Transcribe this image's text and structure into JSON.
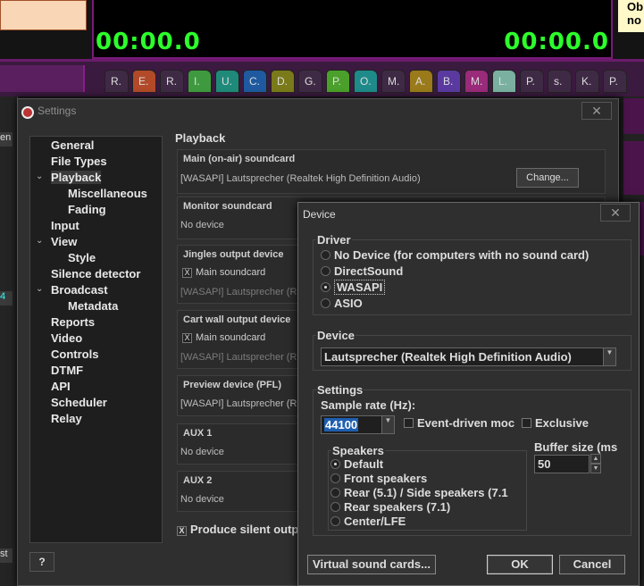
{
  "background": {
    "timer_left": "00:00.0",
    "timer_right": "00:00.0",
    "top_note": "Ob\nno",
    "tabs": [
      {
        "label": "R.",
        "color": "#3f2a45"
      },
      {
        "label": "E.",
        "color": "#b24a2a"
      },
      {
        "label": "R.",
        "color": "#3f2a45"
      },
      {
        "label": "I.",
        "color": "#3f9a3f"
      },
      {
        "label": "U.",
        "color": "#1f8a7a"
      },
      {
        "label": "C.",
        "color": "#1f5aa0"
      },
      {
        "label": "D.",
        "color": "#7a7a1a"
      },
      {
        "label": "G.",
        "color": "#3f2a45"
      },
      {
        "label": "P.",
        "color": "#4aa02a"
      },
      {
        "label": "O.",
        "color": "#1f8a8a"
      },
      {
        "label": "M.",
        "color": "#3f2a45"
      },
      {
        "label": "A.",
        "color": "#9a7a1a"
      },
      {
        "label": "B.",
        "color": "#5a3aa0"
      },
      {
        "label": "M.",
        "color": "#9a2a7a"
      },
      {
        "label": "L.",
        "color": "#7ab0a0"
      },
      {
        "label": "P.",
        "color": "#3f2a45"
      },
      {
        "label": "s.",
        "color": "#3f2a45"
      },
      {
        "label": "K.",
        "color": "#3f2a45"
      },
      {
        "label": "P.",
        "color": "#3f2a45"
      }
    ],
    "left_col_labels": [
      "en",
      "4",
      "st"
    ]
  },
  "settings": {
    "title": "Settings",
    "close": "✕",
    "tree": [
      {
        "label": "General",
        "level": 0,
        "expand": ""
      },
      {
        "label": "File Types",
        "level": 0,
        "expand": ""
      },
      {
        "label": "Playback",
        "level": 0,
        "expand": "⌄",
        "selected": true
      },
      {
        "label": "Miscellaneous",
        "level": 1,
        "expand": ""
      },
      {
        "label": "Fading",
        "level": 1,
        "expand": ""
      },
      {
        "label": "Input",
        "level": 0,
        "expand": ""
      },
      {
        "label": "View",
        "level": 0,
        "expand": "⌄"
      },
      {
        "label": "Style",
        "level": 1,
        "expand": ""
      },
      {
        "label": "Silence detector",
        "level": 0,
        "expand": ""
      },
      {
        "label": "Broadcast",
        "level": 0,
        "expand": "⌄"
      },
      {
        "label": "Metadata",
        "level": 1,
        "expand": ""
      },
      {
        "label": "Reports",
        "level": 0,
        "expand": ""
      },
      {
        "label": "Video",
        "level": 0,
        "expand": ""
      },
      {
        "label": "Controls",
        "level": 0,
        "expand": ""
      },
      {
        "label": "DTMF",
        "level": 0,
        "expand": ""
      },
      {
        "label": "API",
        "level": 0,
        "expand": ""
      },
      {
        "label": "Scheduler",
        "level": 0,
        "expand": ""
      },
      {
        "label": "Relay",
        "level": 0,
        "expand": ""
      }
    ],
    "help": "?",
    "pane_title": "Playback",
    "main_soundcard": {
      "label": "Main (on-air) soundcard",
      "value": "[WASAPI] Lautsprecher (Realtek High Definition Audio)",
      "button": "Change..."
    },
    "monitor_soundcard": {
      "label": "Monitor soundcard",
      "value": "No device"
    },
    "jingles_device": {
      "label": "Jingles output device",
      "check_label": "Main soundcard",
      "value": "[WASAPI] Lautsprecher (Re"
    },
    "cartwall_device": {
      "label": "Cart wall output device",
      "check_label": "Main soundcard",
      "value": "[WASAPI] Lautsprecher (Re"
    },
    "preview_device": {
      "label": "Preview device (PFL)",
      "value": "[WASAPI] Lautsprecher (Re"
    },
    "aux1": {
      "label": "AUX 1",
      "value": "No device"
    },
    "aux2": {
      "label": "AUX 2",
      "value": "No device"
    },
    "silent_output": "Produce silent outp",
    "check_mark": "X"
  },
  "device_dialog": {
    "title": "Device",
    "close": "✕",
    "driver_legend": "Driver",
    "drivers": [
      {
        "label": "No Device (for computers with no sound card)",
        "selected": false
      },
      {
        "label": "DirectSound",
        "selected": false
      },
      {
        "label": "WASAPI",
        "selected": true
      },
      {
        "label": "ASIO",
        "selected": false
      }
    ],
    "device_legend": "Device",
    "device_value": "Lautsprecher (Realtek High Definition Audio)",
    "settings_legend": "Settings",
    "sample_rate_label": "Sample rate (Hz):",
    "sample_rate_value": "44100",
    "event_driven_label": "Event-driven moc",
    "exclusive_label": "Exclusive",
    "speakers_legend": "Speakers",
    "speakers": [
      {
        "label": "Default",
        "selected": true
      },
      {
        "label": "Front speakers",
        "selected": false
      },
      {
        "label": "Rear (5.1) / Side speakers (7.1",
        "selected": false
      },
      {
        "label": "Rear speakers (7.1)",
        "selected": false
      },
      {
        "label": "Center/LFE",
        "selected": false
      }
    ],
    "buffer_label": "Buffer size (ms",
    "buffer_value": "50",
    "virtual_button": "Virtual sound cards...",
    "ok_button": "OK",
    "cancel_button": "Cancel"
  }
}
